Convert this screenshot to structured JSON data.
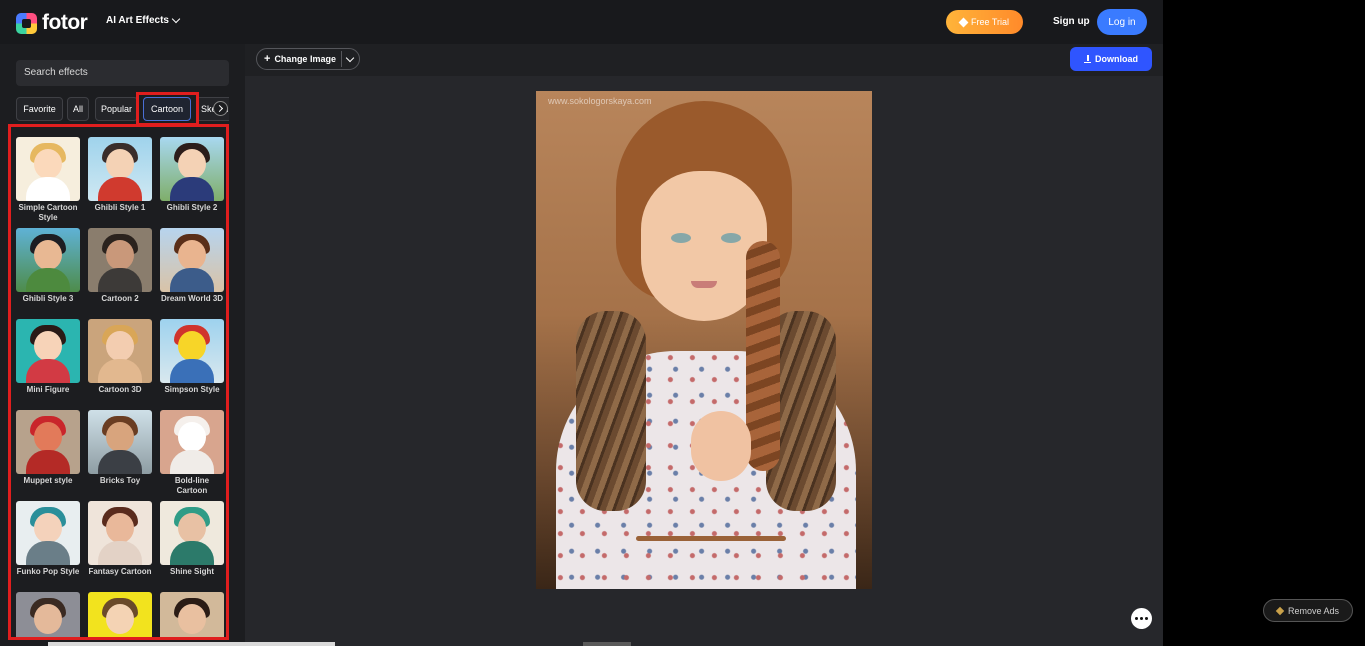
{
  "header": {
    "logo_text": "fotor",
    "menu_label": "AI Art Effects",
    "free_trial_label": "Free Trial",
    "signup_label": "Sign up",
    "login_label": "Log in"
  },
  "sidebar": {
    "search_placeholder": "Search effects",
    "tabs": [
      {
        "label": "Favorite"
      },
      {
        "label": "All"
      },
      {
        "label": "Popular"
      },
      {
        "label": "Cartoon",
        "active": true
      },
      {
        "label": "Sketch"
      }
    ],
    "effects": [
      {
        "label": "Simple Cartoon Style"
      },
      {
        "label": "Ghibli Style 1"
      },
      {
        "label": "Ghibli Style 2"
      },
      {
        "label": "Ghibli Style 3"
      },
      {
        "label": "Cartoon 2"
      },
      {
        "label": "Dream World 3D"
      },
      {
        "label": "Mini Figure"
      },
      {
        "label": "Cartoon 3D"
      },
      {
        "label": "Simpson Style"
      },
      {
        "label": "Muppet style"
      },
      {
        "label": "Bricks Toy"
      },
      {
        "label": "Bold-line Cartoon"
      },
      {
        "label": "Funko Pop Style"
      },
      {
        "label": "Fantasy Cartoon"
      },
      {
        "label": "Shine Sight"
      },
      {
        "label": ""
      },
      {
        "label": ""
      },
      {
        "label": ""
      }
    ]
  },
  "editor": {
    "change_image_label": "Change Image",
    "download_label": "Download",
    "watermark": "www.sokologorskaya.com"
  },
  "ads": {
    "remove_ads_label": "Remove Ads"
  },
  "colors": {
    "accent_blue": "#2f55ff",
    "login_blue": "#3a7bff",
    "trial_orange": "#ff9a30",
    "highlight_red": "#e01e1e"
  }
}
